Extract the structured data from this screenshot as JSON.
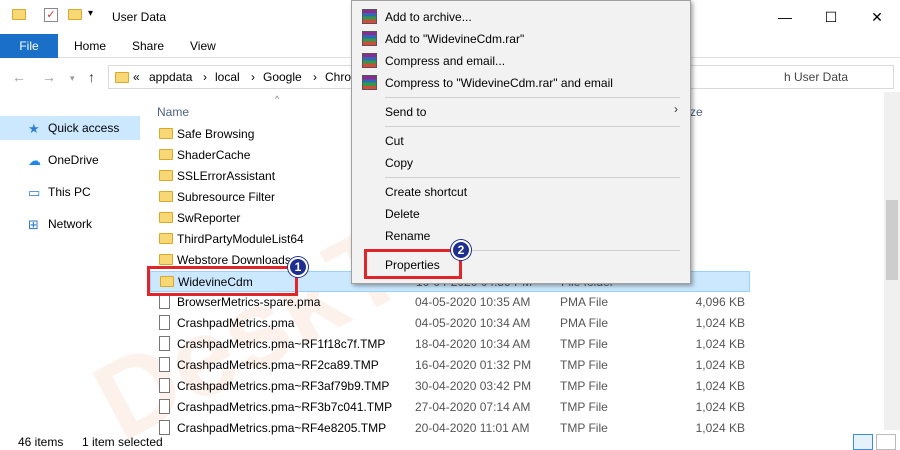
{
  "window": {
    "title": "User Data",
    "minimize": "—",
    "maximize": "☐",
    "close": "✕"
  },
  "ribbon": {
    "tabs": [
      "File",
      "Home",
      "Share",
      "View"
    ]
  },
  "address": {
    "crumbs": [
      "«",
      "appdata",
      "›",
      "local",
      "›",
      "Google",
      "›",
      "Chro"
    ],
    "search_placeholder": "h User Data"
  },
  "nav": {
    "items": [
      {
        "label": "Quick access",
        "icon": "star-icon"
      },
      {
        "label": "OneDrive",
        "icon": "cloud-icon"
      },
      {
        "label": "This PC",
        "icon": "pc-icon"
      },
      {
        "label": "Network",
        "icon": "network-icon"
      }
    ]
  },
  "columns": {
    "name": "Name",
    "size": "ze"
  },
  "files": [
    {
      "name": "Safe Browsing",
      "kind": "folder",
      "date": "",
      "type": "",
      "size": ""
    },
    {
      "name": "ShaderCache",
      "kind": "folder",
      "date": "",
      "type": "",
      "size": ""
    },
    {
      "name": "SSLErrorAssistant",
      "kind": "folder",
      "date": "",
      "type": "",
      "size": ""
    },
    {
      "name": "Subresource Filter",
      "kind": "folder",
      "date": "",
      "type": "",
      "size": ""
    },
    {
      "name": "SwReporter",
      "kind": "folder",
      "date": "",
      "type": "",
      "size": ""
    },
    {
      "name": "ThirdPartyModuleList64",
      "kind": "folder",
      "date": "",
      "type": "",
      "size": ""
    },
    {
      "name": "Webstore Downloads",
      "kind": "folder",
      "date": "",
      "type": "",
      "size": ""
    },
    {
      "name": "WidevineCdm",
      "kind": "folder",
      "date": "10-04-2020 04:59 PM",
      "type": "File folder",
      "size": ""
    },
    {
      "name": "BrowserMetrics-spare.pma",
      "kind": "file",
      "date": "04-05-2020 10:35 AM",
      "type": "PMA File",
      "size": "4,096 KB"
    },
    {
      "name": "CrashpadMetrics.pma",
      "kind": "file",
      "date": "04-05-2020 10:34 AM",
      "type": "PMA File",
      "size": "1,024 KB"
    },
    {
      "name": "CrashpadMetrics.pma~RF1f18c7f.TMP",
      "kind": "file",
      "date": "18-04-2020 10:34 AM",
      "type": "TMP File",
      "size": "1,024 KB"
    },
    {
      "name": "CrashpadMetrics.pma~RF2ca89.TMP",
      "kind": "file",
      "date": "16-04-2020 01:32 PM",
      "type": "TMP File",
      "size": "1,024 KB"
    },
    {
      "name": "CrashpadMetrics.pma~RF3af79b9.TMP",
      "kind": "file",
      "date": "30-04-2020 03:42 PM",
      "type": "TMP File",
      "size": "1,024 KB"
    },
    {
      "name": "CrashpadMetrics.pma~RF3b7c041.TMP",
      "kind": "file",
      "date": "27-04-2020 07:14 AM",
      "type": "TMP File",
      "size": "1,024 KB"
    },
    {
      "name": "CrashpadMetrics.pma~RF4e8205.TMP",
      "kind": "file",
      "date": "20-04-2020 11:01 AM",
      "type": "TMP File",
      "size": "1,024 KB"
    }
  ],
  "status": {
    "count": "46 items",
    "selected": "1 item selected"
  },
  "context_menu": {
    "add_archive": "Add to archive...",
    "add_rar": "Add to \"WidevineCdm.rar\"",
    "compress_email": "Compress and email...",
    "compress_rar_email": "Compress to \"WidevineCdm.rar\" and email",
    "send_to": "Send to",
    "cut": "Cut",
    "copy": "Copy",
    "create_shortcut": "Create shortcut",
    "delete": "Delete",
    "rename": "Rename",
    "properties": "Properties"
  },
  "annotations": {
    "step1": "1",
    "step2": "2"
  },
  "watermark": "DeskTricks",
  "colors": {
    "accent": "#1a6fc8",
    "selection": "#cce8ff",
    "highlight": "#e0252b",
    "badge": "#1f2f8f"
  }
}
